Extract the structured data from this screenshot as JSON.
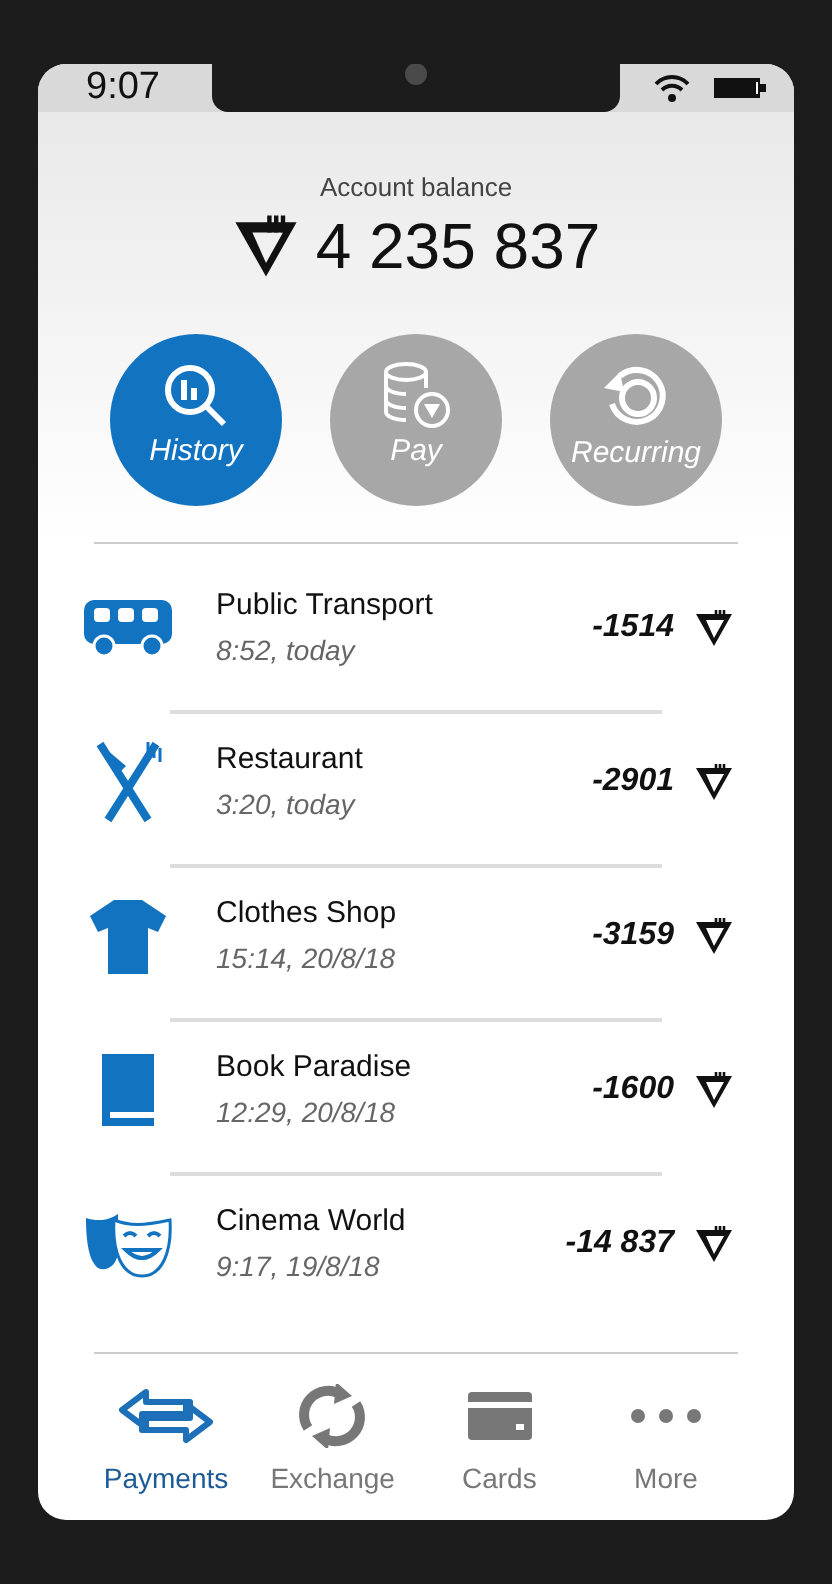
{
  "status_bar": {
    "time": "9:07"
  },
  "balance": {
    "label": "Account balance",
    "amount": "4 235 837"
  },
  "actions": [
    {
      "label": "History",
      "kind": "history",
      "selected": true
    },
    {
      "label": "Pay",
      "kind": "pay",
      "selected": false
    },
    {
      "label": "Recurring",
      "kind": "recurring",
      "selected": false
    }
  ],
  "transactions": [
    {
      "kind": "bus",
      "name": "Public Transport",
      "time": "8:52, today",
      "amount": "-1514"
    },
    {
      "kind": "restaurant",
      "name": "Restaurant",
      "time": "3:20, today",
      "amount": "-2901"
    },
    {
      "kind": "clothes",
      "name": "Clothes Shop",
      "time": "15:14, 20/8/18",
      "amount": "-3159"
    },
    {
      "kind": "book",
      "name": "Book Paradise",
      "time": "12:29, 20/8/18",
      "amount": "-1600"
    },
    {
      "kind": "cinema",
      "name": "Cinema World",
      "time": "9:17, 19/8/18",
      "amount": "-14 837"
    }
  ],
  "bottom_nav": [
    {
      "label": "Payments",
      "kind": "payments",
      "selected": true
    },
    {
      "label": "Exchange",
      "kind": "exchange",
      "selected": false
    },
    {
      "label": "Cards",
      "kind": "cards",
      "selected": false
    },
    {
      "label": "More",
      "kind": "more",
      "selected": false
    }
  ]
}
